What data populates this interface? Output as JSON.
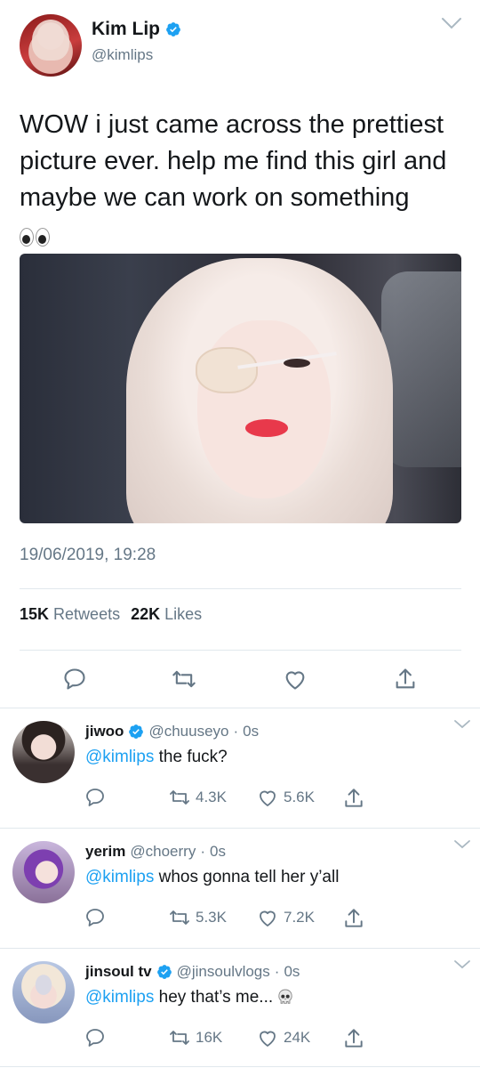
{
  "tweet": {
    "author_name": "Kim Lip",
    "author_handle": "@kimlips",
    "text": "WOW i just came across the prettiest picture ever. help me find this girl and maybe we can work on something",
    "text_emoji": "eyes",
    "timestamp": "19/06/2019, 19:28",
    "retweets_count": "15K",
    "retweets_label": "Retweets",
    "likes_count": "22K",
    "likes_label": "Likes",
    "icons": [
      "reply-icon",
      "retweet-icon",
      "like-icon",
      "share-icon"
    ]
  },
  "replies": [
    {
      "name": "jiwoo",
      "verified": true,
      "handle": "@chuuseyo",
      "time": "0s",
      "mention": "@kimlips",
      "text": "the fuck?",
      "retweets": "4.3K",
      "likes": "5.6K"
    },
    {
      "name": "yerim",
      "verified": false,
      "handle": "@choerry",
      "time": "0s",
      "mention": "@kimlips",
      "text": "whos gonna tell her y’all",
      "retweets": "5.3K",
      "likes": "7.2K"
    },
    {
      "name": "jinsoul tv",
      "verified": true,
      "handle": "@jinsoulvlogs",
      "time": "0s",
      "mention": "@kimlips",
      "text": "hey that’s me...",
      "text_emoji": "skull",
      "retweets": "16K",
      "likes": "24K"
    }
  ],
  "colors": {
    "accent": "#1da1f2",
    "muted": "#657786",
    "text": "#14171a",
    "divider": "#e1e8ed"
  }
}
